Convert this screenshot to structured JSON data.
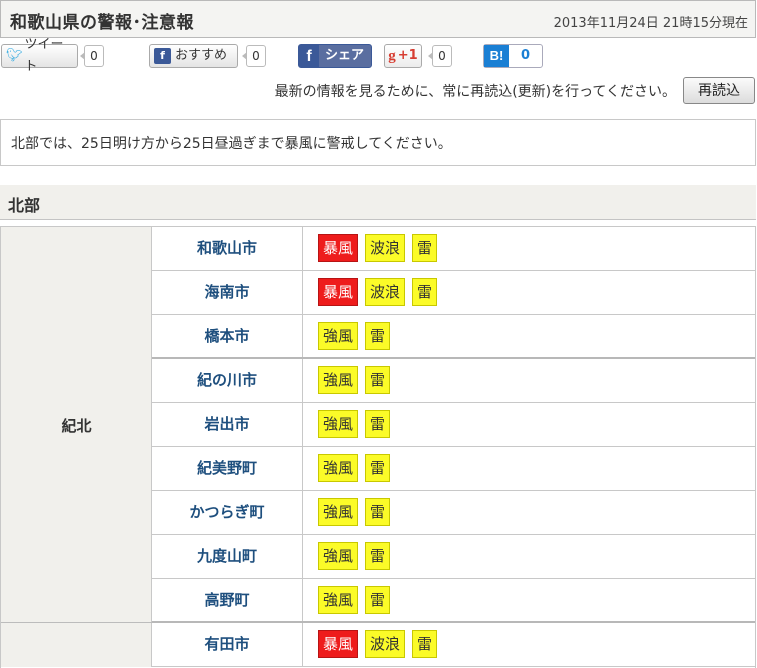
{
  "header": {
    "title": "和歌山県の警報･注意報",
    "timestamp": "2013年11月24日 21時15分現在"
  },
  "share": {
    "tweet_label": "ツイート",
    "tweet_count": "0",
    "osusume_label": "おすすめ",
    "osusume_count": "0",
    "fb_label": "シェア",
    "gplus_label": "+1",
    "gplus_count": "0",
    "hatena_label": "B!",
    "hatena_count": "0"
  },
  "reload": {
    "message": "最新の情報を見るために、常に再読込(更新)を行ってください。",
    "button_label": "再読込"
  },
  "notice": {
    "text": "北部では、25日明け方から25日昼過ぎまで暴風に警戒してください。"
  },
  "region": {
    "heading": "北部",
    "areas": [
      {
        "name": "紀北",
        "rows": [
          {
            "city": "和歌山市",
            "badges": [
              {
                "label": "暴風",
                "level": "warning"
              },
              {
                "label": "波浪",
                "level": "advisory"
              },
              {
                "label": "雷",
                "level": "advisory"
              }
            ]
          },
          {
            "city": "海南市",
            "badges": [
              {
                "label": "暴風",
                "level": "warning"
              },
              {
                "label": "波浪",
                "level": "advisory"
              },
              {
                "label": "雷",
                "level": "advisory"
              }
            ]
          },
          {
            "city": "橋本市",
            "badges": [
              {
                "label": "強風",
                "level": "advisory"
              },
              {
                "label": "雷",
                "level": "advisory"
              }
            ]
          },
          {
            "city": "紀の川市",
            "badges": [
              {
                "label": "強風",
                "level": "advisory"
              },
              {
                "label": "雷",
                "level": "advisory"
              }
            ]
          },
          {
            "city": "岩出市",
            "badges": [
              {
                "label": "強風",
                "level": "advisory"
              },
              {
                "label": "雷",
                "level": "advisory"
              }
            ]
          },
          {
            "city": "紀美野町",
            "badges": [
              {
                "label": "強風",
                "level": "advisory"
              },
              {
                "label": "雷",
                "level": "advisory"
              }
            ]
          },
          {
            "city": "かつらぎ町",
            "badges": [
              {
                "label": "強風",
                "level": "advisory"
              },
              {
                "label": "雷",
                "level": "advisory"
              }
            ]
          },
          {
            "city": "九度山町",
            "badges": [
              {
                "label": "強風",
                "level": "advisory"
              },
              {
                "label": "雷",
                "level": "advisory"
              }
            ]
          },
          {
            "city": "高野町",
            "badges": [
              {
                "label": "強風",
                "level": "advisory"
              },
              {
                "label": "雷",
                "level": "advisory"
              }
            ]
          }
        ]
      },
      {
        "name": "",
        "rows": [
          {
            "city": "有田市",
            "badges": [
              {
                "label": "暴風",
                "level": "warning"
              },
              {
                "label": "波浪",
                "level": "advisory"
              },
              {
                "label": "雷",
                "level": "advisory"
              }
            ]
          }
        ]
      }
    ]
  },
  "colors": {
    "warning": "#ee1c1c",
    "advisory": "#fbfb28",
    "city_link": "#1e4f7e",
    "area_bg": "#f1f0ec"
  }
}
